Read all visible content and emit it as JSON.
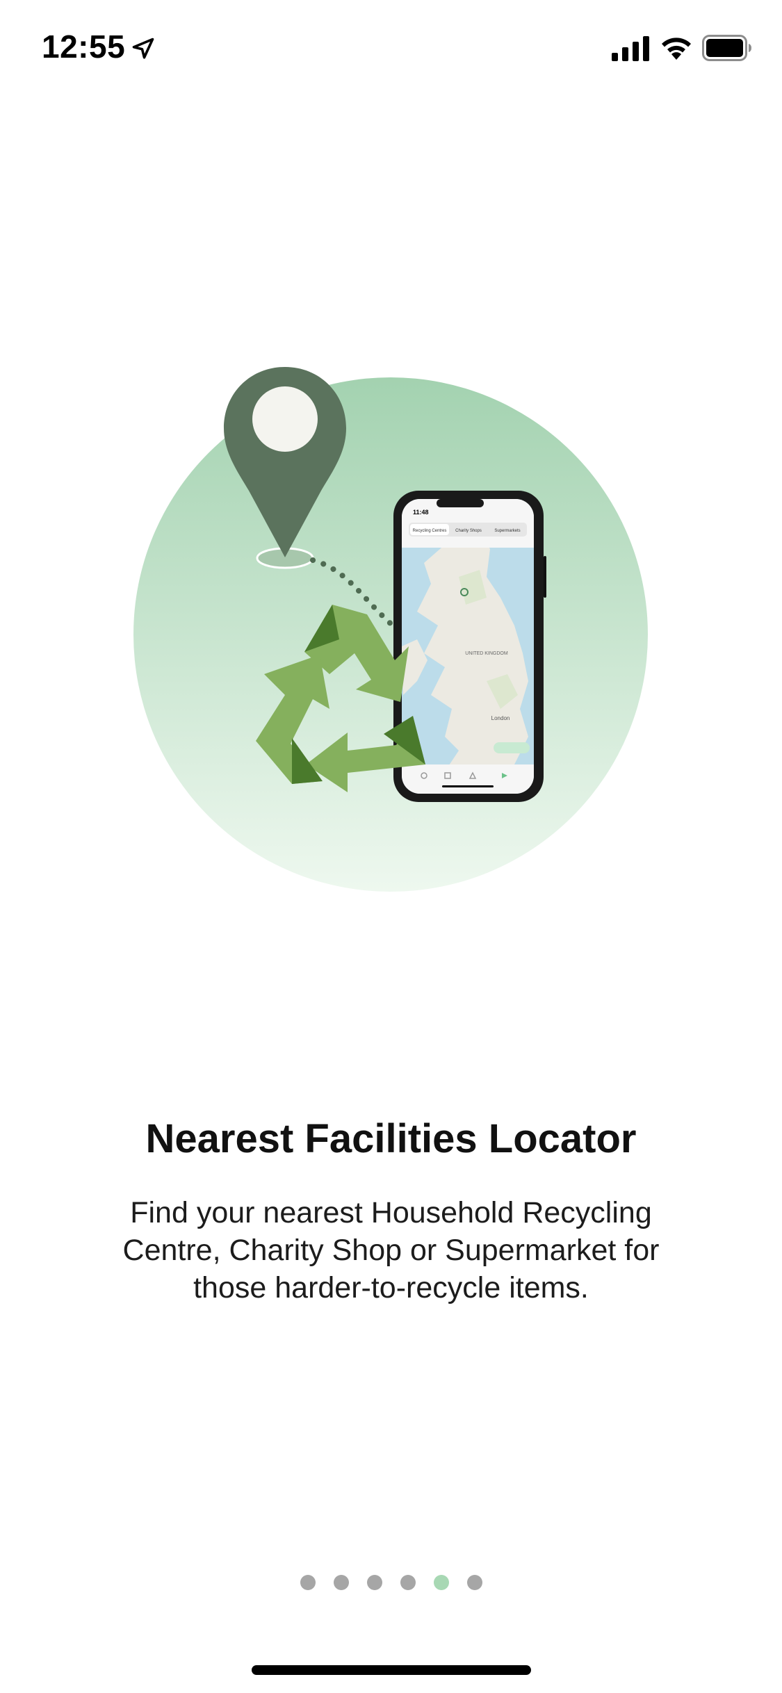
{
  "status_bar": {
    "time": "12:55",
    "icons": [
      "location-arrow-icon",
      "cellular-signal-icon",
      "wifi-icon",
      "battery-icon"
    ]
  },
  "illustration": {
    "icons": [
      "map-pin-icon",
      "recycle-icon",
      "phone-map-icon"
    ],
    "phone_map": {
      "time": "11:48",
      "tabs": [
        "Recycling Centres",
        "Charity Shops",
        "Supermarkets"
      ],
      "labels": [
        "UNITED KINGDOM",
        "London"
      ]
    },
    "colors": {
      "circle_top": "#a3d2b0",
      "circle_bottom": "#eef8ef",
      "pin": "#5b735d",
      "recycle_light": "#85b05d",
      "recycle_dark": "#4a7a2c"
    }
  },
  "onboarding": {
    "title": "Nearest Facilities Locator",
    "description": "Find your nearest Household Recycling Centre, Charity Shop or Supermarket for those harder-to-recycle items."
  },
  "pagination": {
    "total": 6,
    "current": 5,
    "active_color": "#a8d8b4",
    "inactive_color": "#a6a6a6"
  }
}
